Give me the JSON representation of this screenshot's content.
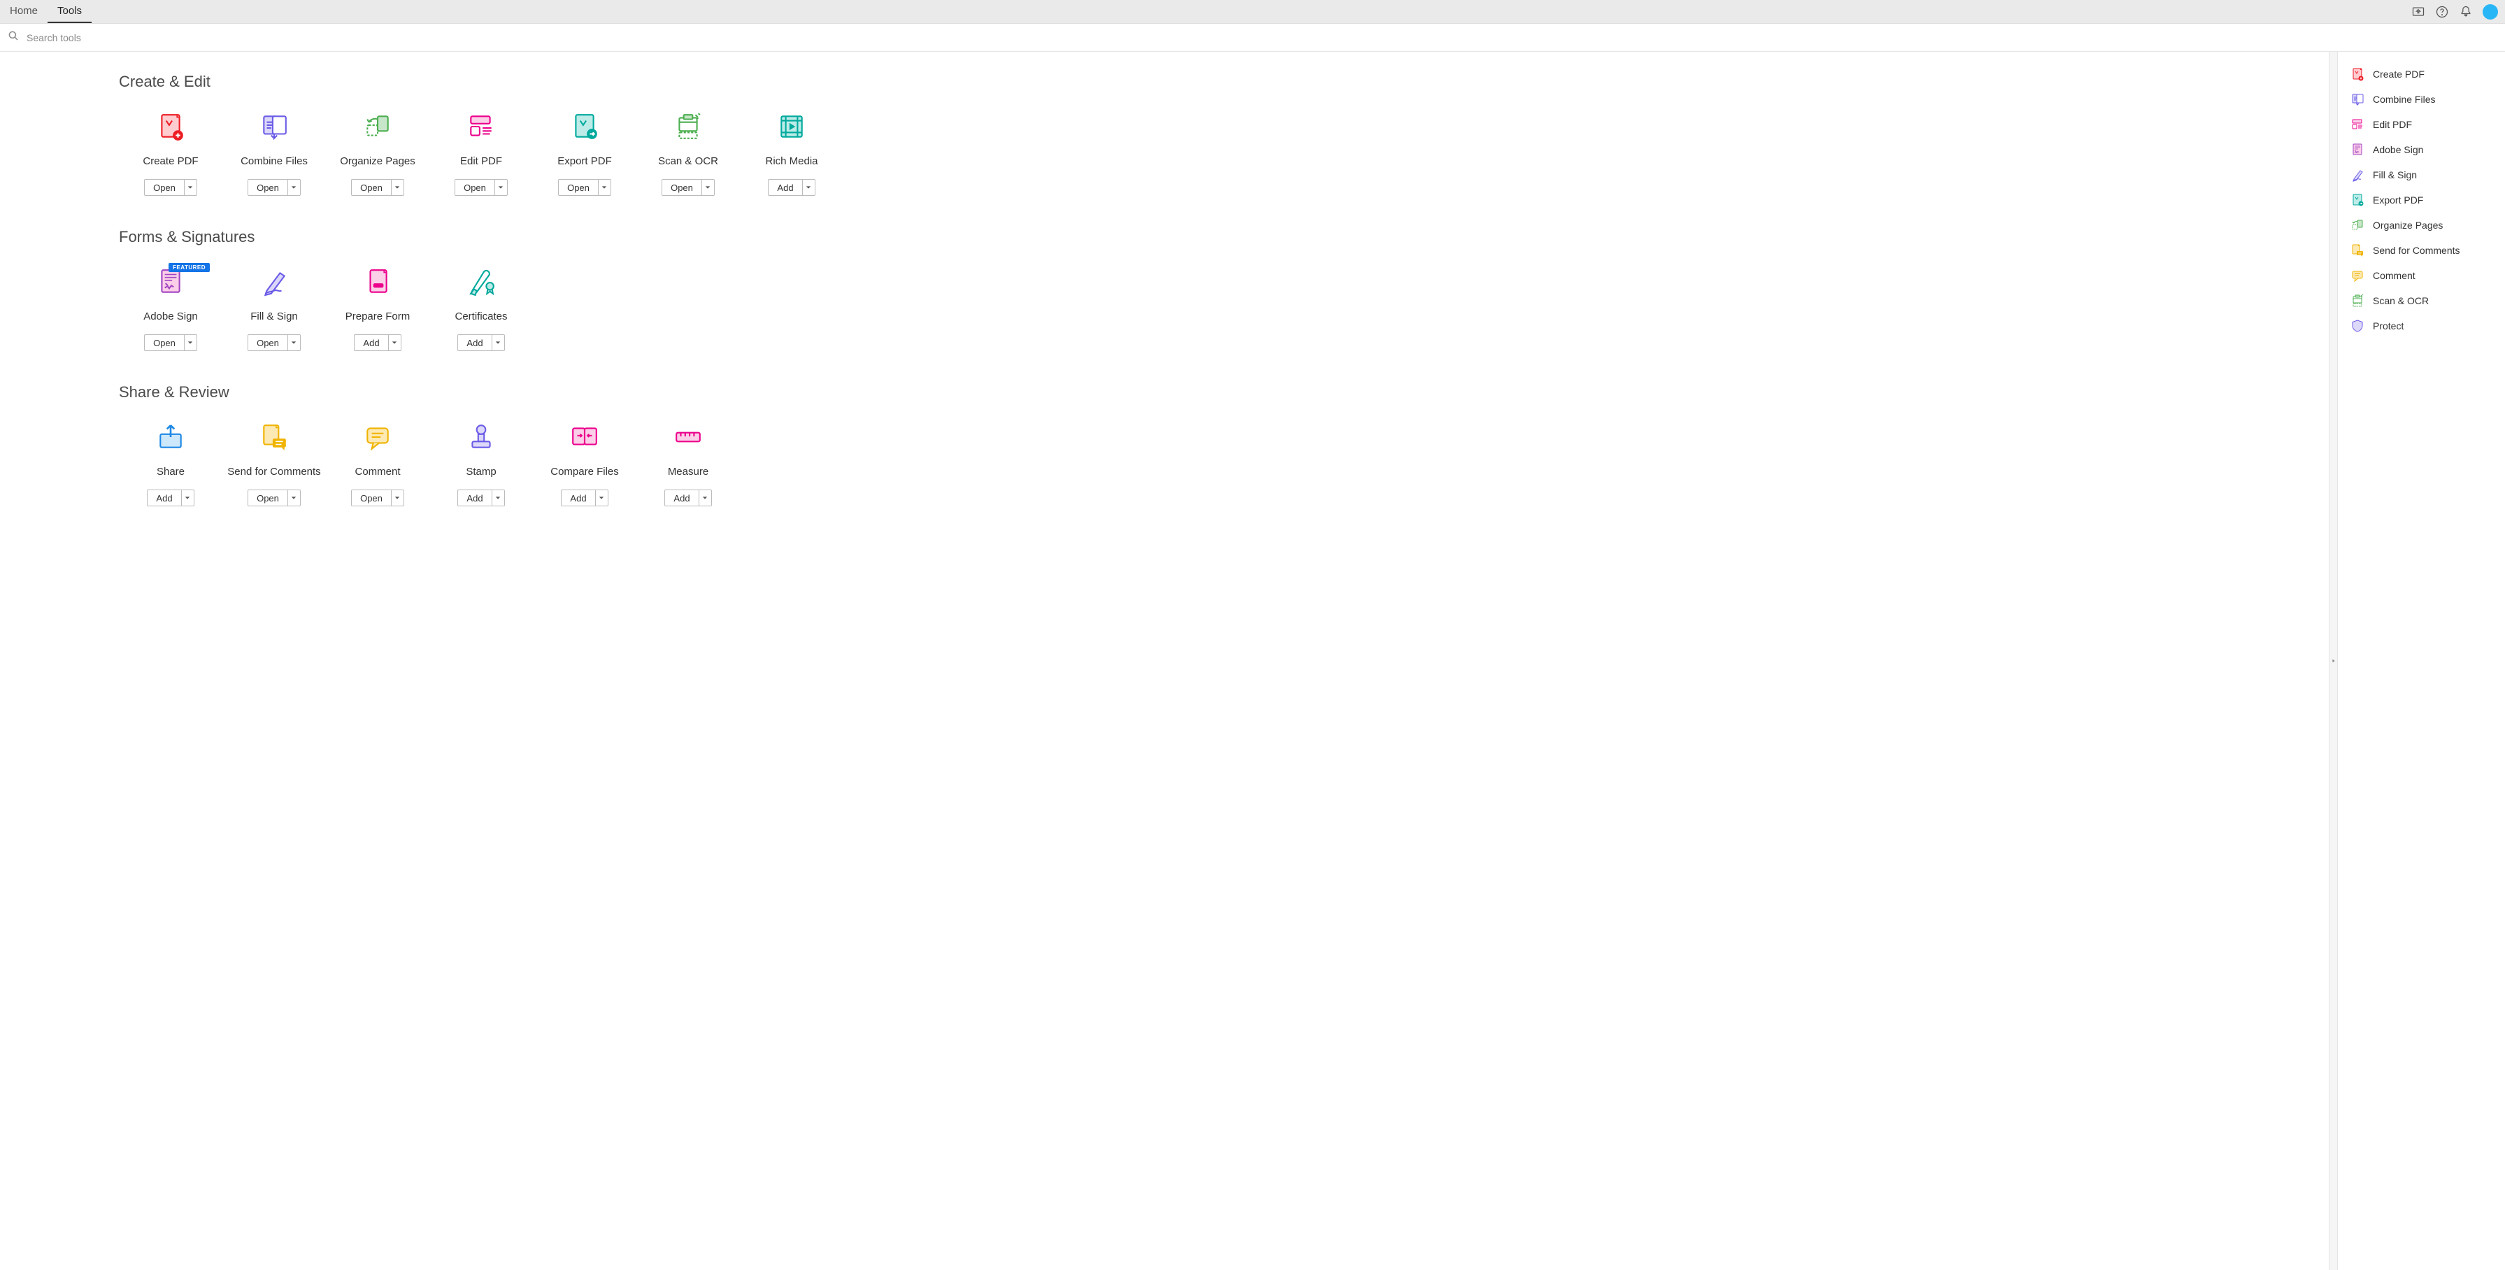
{
  "topbar": {
    "tabs": [
      {
        "label": "Home",
        "active": false
      },
      {
        "label": "Tools",
        "active": true
      }
    ]
  },
  "search": {
    "placeholder": "Search tools"
  },
  "sections": [
    {
      "title": "Create & Edit",
      "tools": [
        {
          "label": "Create PDF",
          "action": "Open",
          "icon": "create-pdf",
          "color": "red"
        },
        {
          "label": "Combine Files",
          "action": "Open",
          "icon": "combine-files",
          "color": "purple"
        },
        {
          "label": "Organize Pages",
          "action": "Open",
          "icon": "organize-pages",
          "color": "green"
        },
        {
          "label": "Edit PDF",
          "action": "Open",
          "icon": "edit-pdf",
          "color": "pink"
        },
        {
          "label": "Export PDF",
          "action": "Open",
          "icon": "export-pdf",
          "color": "teal"
        },
        {
          "label": "Scan & OCR",
          "action": "Open",
          "icon": "scan-ocr",
          "color": "green"
        },
        {
          "label": "Rich Media",
          "action": "Add",
          "icon": "rich-media",
          "color": "teal"
        }
      ]
    },
    {
      "title": "Forms & Signatures",
      "tools": [
        {
          "label": "Adobe Sign",
          "action": "Open",
          "icon": "adobe-sign",
          "color": "pink",
          "badge": "FEATURED"
        },
        {
          "label": "Fill & Sign",
          "action": "Open",
          "icon": "fill-sign",
          "color": "purple"
        },
        {
          "label": "Prepare Form",
          "action": "Add",
          "icon": "prepare-form",
          "color": "pink"
        },
        {
          "label": "Certificates",
          "action": "Add",
          "icon": "certificates",
          "color": "teal"
        }
      ]
    },
    {
      "title": "Share & Review",
      "tools": [
        {
          "label": "Share",
          "action": "Add",
          "icon": "share",
          "color": "blue"
        },
        {
          "label": "Send for Comments",
          "action": "Open",
          "icon": "send-comments",
          "color": "yellow"
        },
        {
          "label": "Comment",
          "action": "Open",
          "icon": "comment",
          "color": "yellow"
        },
        {
          "label": "Stamp",
          "action": "Add",
          "icon": "stamp",
          "color": "purple"
        },
        {
          "label": "Compare Files",
          "action": "Add",
          "icon": "compare-files",
          "color": "pink"
        },
        {
          "label": "Measure",
          "action": "Add",
          "icon": "measure",
          "color": "pink"
        }
      ]
    }
  ],
  "rightPanel": [
    {
      "label": "Create PDF",
      "icon": "create-pdf",
      "color": "red"
    },
    {
      "label": "Combine Files",
      "icon": "combine-files",
      "color": "purple"
    },
    {
      "label": "Edit PDF",
      "icon": "edit-pdf",
      "color": "pink"
    },
    {
      "label": "Adobe Sign",
      "icon": "adobe-sign",
      "color": "pink"
    },
    {
      "label": "Fill & Sign",
      "icon": "fill-sign",
      "color": "purple"
    },
    {
      "label": "Export PDF",
      "icon": "export-pdf",
      "color": "teal"
    },
    {
      "label": "Organize Pages",
      "icon": "organize-pages",
      "color": "green"
    },
    {
      "label": "Send for Comments",
      "icon": "send-comments",
      "color": "yellow"
    },
    {
      "label": "Comment",
      "icon": "comment",
      "color": "yellow"
    },
    {
      "label": "Scan & OCR",
      "icon": "scan-ocr",
      "color": "green"
    },
    {
      "label": "Protect",
      "icon": "protect",
      "color": "purple"
    }
  ]
}
